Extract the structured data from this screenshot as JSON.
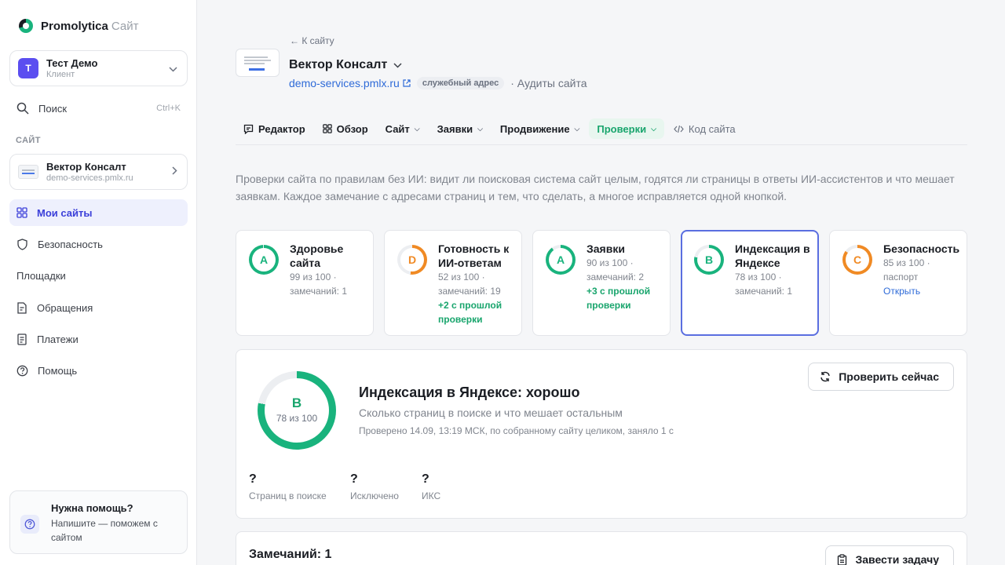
{
  "app": {
    "name": "Promolytica",
    "section": "Сайт"
  },
  "account": {
    "initial": "Т",
    "name": "Тест Демо",
    "role": "Клиент"
  },
  "search": {
    "label": "Поиск",
    "shortcut": "Ctrl+K"
  },
  "sidebar": {
    "site_section_label": "САЙТ",
    "site": {
      "name": "Вектор Консалт",
      "host": "demo-services.pmlx.ru"
    },
    "items": [
      {
        "label": "Мои сайты",
        "icon": "grid-icon",
        "active": true
      },
      {
        "label": "Безопасность",
        "icon": "shield-icon"
      },
      {
        "label": "Площадки"
      },
      {
        "label": "Обращения",
        "icon": "document-icon"
      },
      {
        "label": "Платежи",
        "icon": "receipt-icon"
      },
      {
        "label": "Помощь",
        "icon": "help-icon"
      }
    ],
    "help": {
      "title": "Нужна помощь?",
      "body": "Напишите — поможем с сайтом"
    }
  },
  "header": {
    "back": "К сайту",
    "title": "Вектор Консалт",
    "link": "demo-services.pmlx.ru",
    "badge": "служебный адрес",
    "audits": "· Аудиты сайта"
  },
  "tabs": [
    {
      "label": "Редактор",
      "icon": "chat-icon"
    },
    {
      "label": "Обзор",
      "icon": "grid-icon"
    },
    {
      "label": "Сайт",
      "dropdown": true
    },
    {
      "label": "Заявки",
      "dropdown": true
    },
    {
      "label": "Продвижение",
      "dropdown": true
    },
    {
      "label": "Проверки",
      "dropdown": true,
      "active": true
    },
    {
      "label": "Код сайта",
      "icon": "code-icon"
    }
  ],
  "intro": "Проверки сайта по правилам без ИИ: видит ли поисковая система сайт целым, годятся ли страницы в ответы ИИ-ассистентов и что мешает заявкам. Каждое замечание с адресами страниц и тем, что сделать, а многое исправляется одной кнопкой.",
  "cards": [
    {
      "grade": "A",
      "score": 99,
      "color": "#19b37d",
      "title": "Здоровье сайта",
      "meta1": "99 из 100 ·",
      "meta2": "замечаний: 1",
      "delta": "",
      "link": ""
    },
    {
      "grade": "D",
      "score": 52,
      "color": "#f08a24",
      "title": "Готовность к ИИ-ответам",
      "meta1": "52 из 100 ·",
      "meta2": "замечаний: 19",
      "delta": "+2 с прошлой проверки",
      "link": ""
    },
    {
      "grade": "A",
      "score": 90,
      "color": "#19b37d",
      "title": "Заявки",
      "meta1": "90 из 100 ·",
      "meta2": "замечаний: 2",
      "delta": "+3 с прошлой проверки",
      "link": ""
    },
    {
      "grade": "B",
      "score": 78,
      "color": "#19b37d",
      "title": "Индексация в Яндексе",
      "meta1": "78 из 100 ·",
      "meta2": "замечаний: 1",
      "delta": "",
      "link": "",
      "selected": true
    },
    {
      "grade": "C",
      "score": 85,
      "color": "#f08a24",
      "title": "Безопасность",
      "meta1": "85 из 100 ·",
      "meta2": "паспорт",
      "delta": "",
      "link": "Открыть"
    }
  ],
  "detail": {
    "grade": "B",
    "score_text": "78 из 100",
    "score": 78,
    "title": "Индексация в Яндексе: хорошо",
    "subtitle": "Сколько страниц в поиске и что мешает остальным",
    "meta": "Проверено 14.09, 13:19 МСК, по собранному сайту целиком, заняло 1 с",
    "button": "Проверить сейчас",
    "stats": [
      {
        "value": "?",
        "label": "Страниц в поиске"
      },
      {
        "value": "?",
        "label": "Исключено"
      },
      {
        "value": "?",
        "label": "ИКС"
      }
    ]
  },
  "issues": {
    "title": "Замечаний: 1",
    "button": "Завести задачу"
  }
}
